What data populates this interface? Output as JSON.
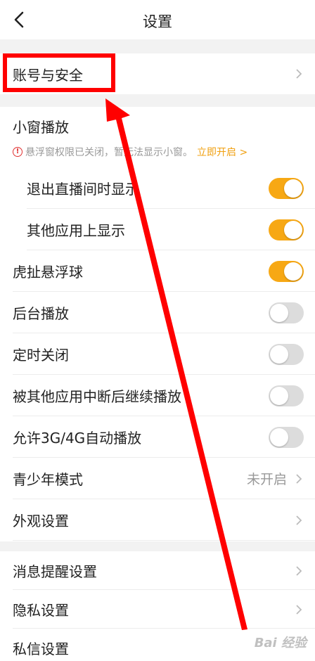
{
  "header": {
    "title": "设置",
    "back_icon": "chevron-left-icon"
  },
  "account": {
    "label": "账号与安全"
  },
  "mini_window": {
    "title": "小窗播放",
    "notice_icon": "!",
    "notice_text": "悬浮窗权限已关闭，暂无法显示小窗。",
    "notice_link": "立即开启 >",
    "items": [
      {
        "label": "退出直播间时显示",
        "on": true
      },
      {
        "label": "其他应用上显示",
        "on": true
      }
    ]
  },
  "settings": [
    {
      "label": "虎扯悬浮球",
      "type": "toggle",
      "on": true
    },
    {
      "label": "后台播放",
      "type": "toggle",
      "on": false
    },
    {
      "label": "定时关闭",
      "type": "toggle",
      "on": false
    },
    {
      "label": "被其他应用中断后继续播放",
      "type": "toggle",
      "on": false
    },
    {
      "label": "允许3G/4G自动播放",
      "type": "toggle",
      "on": false
    },
    {
      "label": "青少年模式",
      "type": "value",
      "value": "未开启"
    },
    {
      "label": "外观设置",
      "type": "link"
    }
  ],
  "settings2": [
    {
      "label": "消息提醒设置"
    },
    {
      "label": "隐私设置"
    },
    {
      "label": "私信设置"
    }
  ],
  "watermark": "Bai 经验",
  "colors": {
    "toggle_on": "#f7a814",
    "toggle_off": "#dcdcdc",
    "annotation": "#ff0000",
    "link": "#f0a010"
  }
}
